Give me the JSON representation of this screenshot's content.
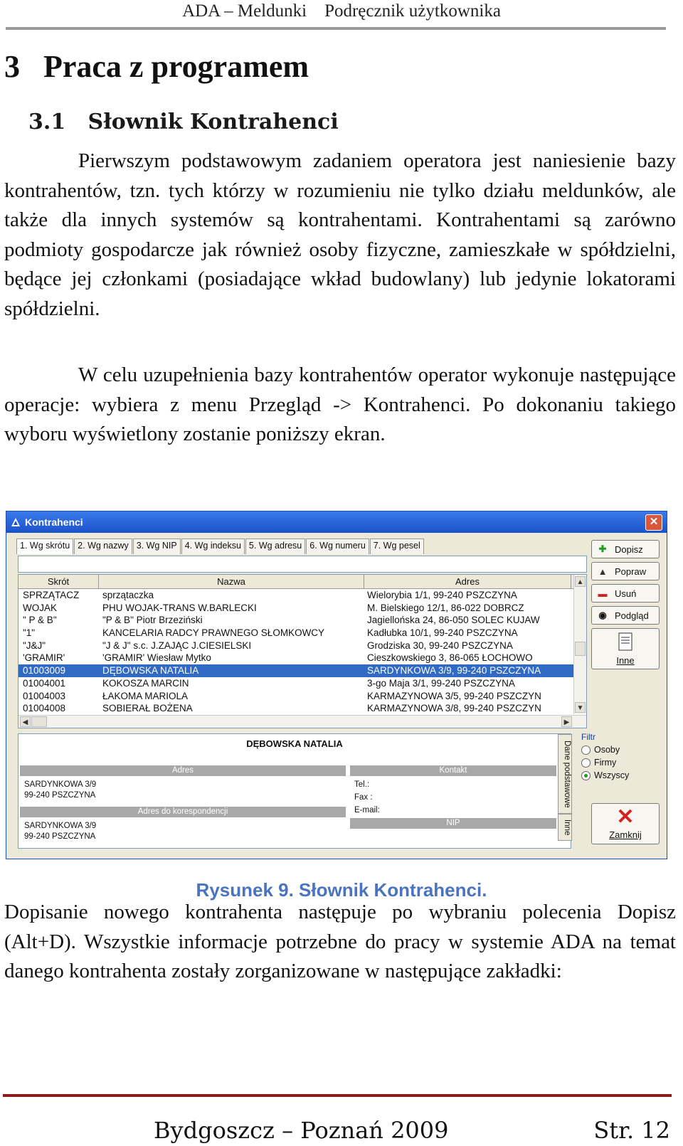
{
  "header": {
    "title": "ADA – Meldunki    Podręcznik użytkownika"
  },
  "chapter_title": "3   Praca z programem",
  "section_title": "3.1   Słownik Kontrahenci",
  "paragraphs": [
    "Pierwszym podstawowym zadaniem operatora jest naniesienie bazy kontrahentów, tzn. tych którzy w rozumieniu nie tylko działu meldunków, ale także dla innych systemów są kontrahentami. Kontrahentami są zarówno podmioty gospodarcze jak również osoby fizyczne, zamieszkałe w spółdzielni, będące jej członkami (posiadające wkład budowlany) lub jedynie lokatorami spółdzielni.",
    "W celu uzupełnienia bazy kontrahentów operator wykonuje następujące operacje: wybiera z menu Przegląd -> Kontrahenci. Po dokonaniu takiego wyboru wyświetlony zostanie poniższy ekran.",
    "Dopisanie nowego kontrahenta następuje po wybraniu polecenia Dopisz (Alt+D). Wszystkie informacje potrzebne do pracy w systemie ADA na temat danego kontrahenta zostały zorganizowane w następujące zakładki:"
  ],
  "window": {
    "title": "Kontrahenci",
    "close": "✕",
    "tabs": [
      "1. Wg skrótu",
      "2. Wg nazwy",
      "3. Wg NIP",
      "4. Wg indeksu",
      "5. Wg adresu",
      "6. Wg numeru",
      "7. Wg pesel"
    ],
    "columns": [
      "Skrót",
      "Nazwa",
      "Adres"
    ],
    "rows": [
      [
        "SPRZĄTACZ",
        "sprzątaczka",
        "Wielorybia 1/1, 99-240 PSZCZYNA"
      ],
      [
        "WOJAK",
        "PHU WOJAK-TRANS W.BARLECKI",
        "M. Bielskiego 12/1, 86-022 DOBRCZ"
      ],
      [
        "\" P & B\"",
        "\"P & B\" Piotr Brzeziński",
        "Jagiellońska 24, 86-050 SOLEC KUJAW"
      ],
      [
        "\"1\"",
        "KANCELARIA RADCY PRAWNEGO SŁOMKOWCY",
        "Kadłubka 10/1, 99-240 PSZCZYNA"
      ],
      [
        "\"J&J\"",
        "\"J & J\" s.c. J.ZAJĄC J.CIESIELSKI",
        "Grodziska 30, 99-240 PSZCZYNA"
      ],
      [
        "'GRAMIR'",
        "'GRAMIR' Wiesław Mytko",
        "Cieszkowskiego 3, 86-065 ŁOCHOWO"
      ],
      [
        "01003009",
        "DĘBOWSKA NATALIA",
        "SARDYNKOWA 3/9, 99-240 PSZCZYNA"
      ],
      [
        "01004001",
        "KOKOSZA MARCIN",
        "3-go Maja 3/1, 99-240 PSZCZYNA"
      ],
      [
        "01004003",
        "ŁAKOMA MARIOLA",
        "KARMAZYNOWA 3/5, 99-240 PSZCZYN"
      ],
      [
        "01004008",
        "SOBIERAŁ BOŻENA",
        "KARMAZYNOWA 3/8, 99-240 PSZCZYN"
      ]
    ],
    "selected_row": 6,
    "buttons": {
      "add": "Dopisz",
      "edit": "Popraw",
      "delete": "Usuń",
      "preview": "Podgląd",
      "other": "Inne",
      "close": "Zamknij"
    },
    "detail": {
      "name": "DĘBOWSKA NATALIA",
      "address_header": "Adres",
      "address_line1": "SARDYNKOWA 3/9",
      "address_line2": "99-240 PSZCZYNA",
      "corr_header": "Adres do korespondencji",
      "corr_line1": "SARDYNKOWA 3/9",
      "corr_line2": "99-240 PSZCZYNA",
      "contact_header": "Kontakt",
      "tel": "Tel.:",
      "fax": "Fax :",
      "email": "E-mail:",
      "nip_header": "NIP",
      "vtab_main": "Dane podstawowe",
      "vtab_other": "Inne"
    },
    "filter": {
      "label": "Filtr",
      "options": [
        "Osoby",
        "Firmy",
        "Wszyscy"
      ],
      "selected": "Wszyscy"
    }
  },
  "caption": "Rysunek 9. Słownik Kontrahenci.",
  "footer": {
    "left": "Bydgoszcz – Poznań 2009",
    "right": "Str. 12"
  },
  "colors": {
    "caption": "#4a73c0",
    "footer_rule": "#8b1c1c",
    "selection": "#316ac5"
  }
}
